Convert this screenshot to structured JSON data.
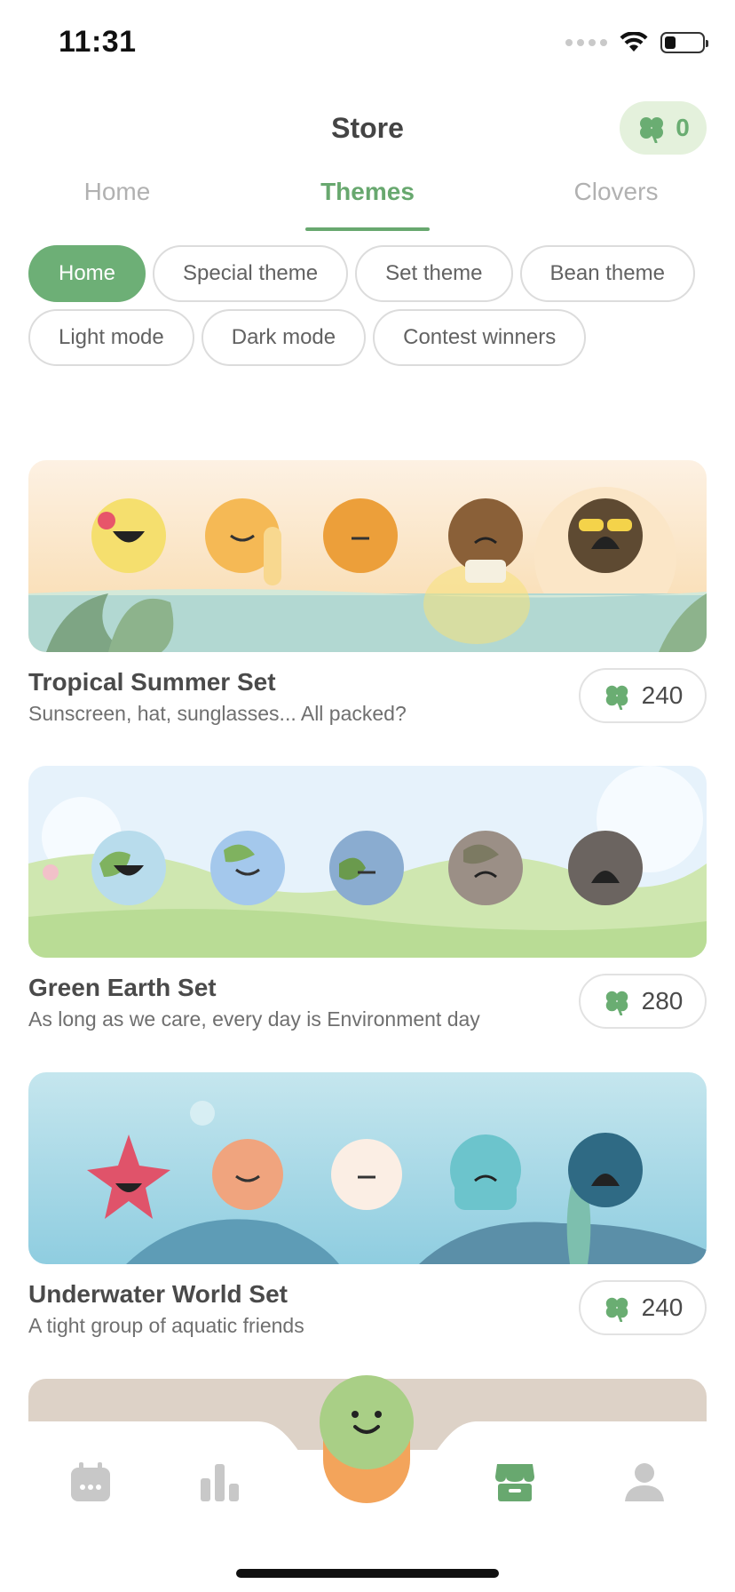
{
  "status_bar": {
    "time": "11:31"
  },
  "header": {
    "title": "Store",
    "clover_count": "0"
  },
  "colors": {
    "accent": "#68a86f",
    "chip_active": "#6daf76",
    "balance_bg": "#e4f1dc"
  },
  "tabs": [
    {
      "label": "Home",
      "active": false
    },
    {
      "label": "Themes",
      "active": true
    },
    {
      "label": "Clovers",
      "active": false
    }
  ],
  "chips": [
    {
      "label": "Home",
      "active": true
    },
    {
      "label": "Special theme",
      "active": false
    },
    {
      "label": "Set theme",
      "active": false
    },
    {
      "label": "Bean theme",
      "active": false
    },
    {
      "label": "Light mode",
      "active": false
    },
    {
      "label": "Dark mode",
      "active": false
    },
    {
      "label": "Contest winners",
      "active": false
    }
  ],
  "themes": [
    {
      "title": "Tropical Summer Set",
      "description": "Sunscreen, hat, sunglasses... All packed?",
      "price": "240"
    },
    {
      "title": "Green Earth Set",
      "description": "As long as we care, every day is Environment day",
      "price": "280"
    },
    {
      "title": "Underwater World Set",
      "description": "A tight group of aquatic friends",
      "price": "240"
    }
  ],
  "bottom_nav": [
    {
      "icon": "calendar-icon"
    },
    {
      "icon": "stats-icon"
    },
    {
      "icon": "mood-bean-icon"
    },
    {
      "icon": "store-icon",
      "active": true
    },
    {
      "icon": "profile-icon"
    }
  ]
}
